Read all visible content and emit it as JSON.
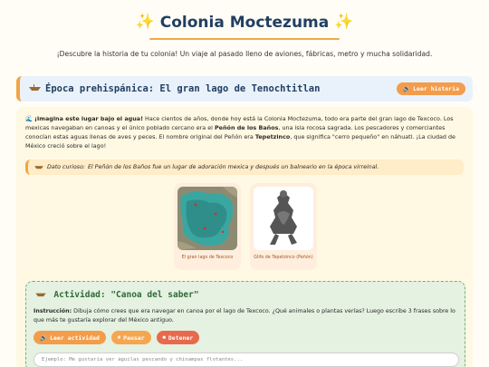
{
  "header": {
    "title": "Colonia Moctezuma",
    "subtitle": "¡Descubre la historia de tu colonia! Un viaje al pasado lleno de aviones, fábricas, metro y mucha solidaridad."
  },
  "section": {
    "title": "Época prehispánica: El gran lago de Tenochtitlan",
    "listen_button": "Leer historia"
  },
  "intro": {
    "lead": "¡Imagina este lugar bajo el agua!",
    "text_1": " Hace cientos de años, donde hoy está la Colonia Moctezuma, todo era parte del gran lago de Texcoco. Los mexicas navegaban en canoas y el único poblado cercano era el ",
    "bold_1": "Peñón de los Baños",
    "text_2": ", una isla rocosa sagrada. Los pescadores y comerciantes conocían estas aguas llenas de aves y peces. El nombre original del Peñón era ",
    "bold_2": "Tepetzinco",
    "text_3": ", que significa \"cerro pequeño\" en náhuatl. ¡La ciudad de México creció sobre el lago!"
  },
  "fact": {
    "label": "Dato curioso:",
    "text": "El Peñón de los Baños fue un lugar de adoración mexica y después un balneario en la época virreinal."
  },
  "figures": [
    {
      "caption": "El gran lago de Texcoco"
    },
    {
      "caption": "Glifo de Tepetzinco (Peñón)"
    }
  ],
  "activity": {
    "title": "Actividad: \"Canoa del saber\"",
    "instruction_label": "Instrucción:",
    "instruction": "Dibuja cómo crees que era navegar en canoa por el lago de Texcoco. ¿Qué animales o plantas verías? Luego escribe 3 frases sobre lo que más te gustaría explorar del México antiguo.",
    "buttons": {
      "read": "Leer actividad",
      "pause": "Pausar",
      "stop": "Detener"
    },
    "input_placeholder": "Ejemplo: Me gustaría ver águilas pescando y chinampas flotantes..."
  },
  "colors": {
    "accent_orange": "#f39c4a",
    "title_navy": "#213f63",
    "activity_green": "#2f6b38"
  }
}
